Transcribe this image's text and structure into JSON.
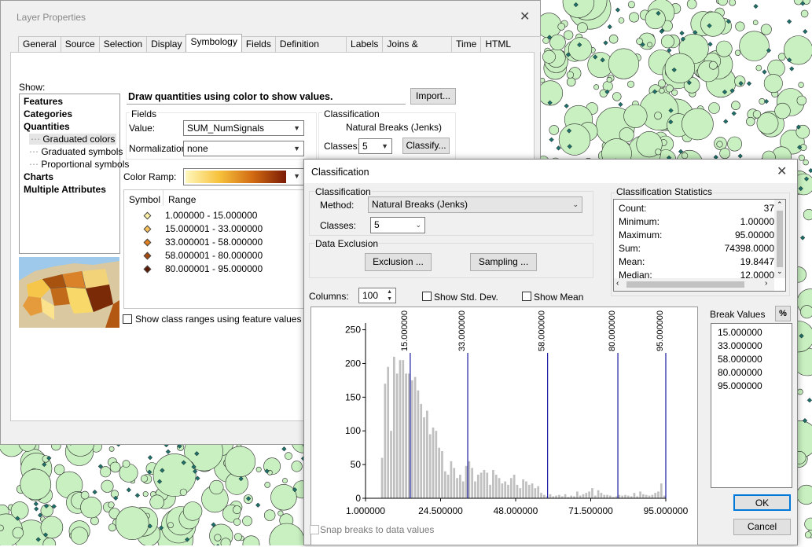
{
  "colors": {
    "map_fill": "#c8f0c0",
    "map_stroke": "#2a2a2a",
    "map_dot": "#1f6f6a",
    "ramp_start": "#fff7bc",
    "ramp_end": "#7a1a05",
    "break_line": "#1a1aa0",
    "bar": "#c0c0c0"
  },
  "layer_props": {
    "title": "Layer Properties",
    "tabs": [
      "General",
      "Source",
      "Selection",
      "Display",
      "Symbology",
      "Fields",
      "Definition Query",
      "Labels",
      "Joins & Relates",
      "Time",
      "HTML Popup"
    ],
    "active_tab": "Symbology",
    "show_label": "Show:",
    "tree": [
      {
        "label": "Features",
        "level": 0
      },
      {
        "label": "Categories",
        "level": 0
      },
      {
        "label": "Quantities",
        "level": 0
      },
      {
        "label": "Graduated colors",
        "level": 1,
        "selected": true
      },
      {
        "label": "Graduated symbols",
        "level": 1
      },
      {
        "label": "Proportional symbols",
        "level": 1
      },
      {
        "label": "Charts",
        "level": 0
      },
      {
        "label": "Multiple Attributes",
        "level": 0
      }
    ],
    "heading": "Draw quantities using color to show values.",
    "import_label": "Import...",
    "fields_group": "Fields",
    "value_label": "Value:",
    "value": "SUM_NumSignals",
    "normalization_label": "Normalization:",
    "normalization": "none",
    "classification_group": "Classification",
    "classification_method": "Natural Breaks (Jenks)",
    "classes_label": "Classes:",
    "classes": "5",
    "classify_label": "Classify...",
    "color_ramp_label": "Color Ramp:",
    "symbol_header": "Symbol",
    "range_header": "Range",
    "ranges": [
      {
        "range": "1.000000 - 15.000000",
        "color": "#fff2a8"
      },
      {
        "range": "15.000001 - 33.000000",
        "color": "#f9c25a"
      },
      {
        "range": "33.000001 - 58.000000",
        "color": "#e07f1d"
      },
      {
        "range": "58.000001 - 80.000000",
        "color": "#a84a0d"
      },
      {
        "range": "80.000001 - 95.000000",
        "color": "#5e1b04"
      }
    ],
    "show_class_ranges": "Show class ranges using feature values"
  },
  "classification": {
    "title": "Classification",
    "group_label": "Classification",
    "method_label": "Method:",
    "method": "Natural Breaks (Jenks)",
    "classes_label": "Classes:",
    "classes": "5",
    "data_exclusion_label": "Data Exclusion",
    "exclusion_btn": "Exclusion ...",
    "sampling_btn": "Sampling ...",
    "stats_label": "Classification Statistics",
    "stats": [
      {
        "name": "Count:",
        "value": "37"
      },
      {
        "name": "Minimum:",
        "value": "1.00000"
      },
      {
        "name": "Maximum:",
        "value": "95.00000"
      },
      {
        "name": "Sum:",
        "value": "74398.0000"
      },
      {
        "name": "Mean:",
        "value": "19.8447"
      },
      {
        "name": "Median:",
        "value": "12.0000"
      }
    ],
    "columns_label": "Columns:",
    "columns": "100",
    "show_std_dev": "Show Std. Dev.",
    "show_mean": "Show Mean",
    "break_values_label": "Break Values",
    "percent_btn": "%",
    "break_values": [
      "15.000000",
      "33.000000",
      "58.000000",
      "80.000000",
      "95.000000"
    ],
    "ok_label": "OK",
    "cancel_label": "Cancel",
    "snap_label": "Snap breaks to data values"
  },
  "chart_data": {
    "type": "bar",
    "xlim": [
      1,
      95
    ],
    "ylim": [
      0,
      260
    ],
    "x_ticks": [
      "1.000000",
      "24.500000",
      "48.000000",
      "71.500000",
      "95.000000"
    ],
    "y_ticks": [
      "0",
      "50",
      "100",
      "150",
      "200",
      "250"
    ],
    "break_labels": [
      "15.000000",
      "33.000000",
      "58.000000",
      "80.000000",
      "95.000000"
    ],
    "breaks": [
      15,
      33,
      58,
      80,
      95
    ],
    "values": [
      0,
      0,
      0,
      0,
      0,
      60,
      170,
      195,
      100,
      210,
      185,
      205,
      205,
      185,
      185,
      175,
      180,
      160,
      140,
      120,
      130,
      95,
      105,
      100,
      75,
      70,
      40,
      35,
      55,
      45,
      30,
      35,
      25,
      48,
      55,
      45,
      25,
      35,
      38,
      42,
      38,
      20,
      42,
      35,
      30,
      22,
      25,
      20,
      30,
      35,
      20,
      15,
      28,
      25,
      20,
      22,
      15,
      18,
      8,
      5,
      3,
      6,
      3,
      4,
      5,
      3,
      6,
      2,
      4,
      3,
      10,
      4,
      6,
      8,
      10,
      15,
      4,
      12,
      8,
      5,
      5,
      4,
      2,
      3,
      5,
      4,
      5,
      4,
      3,
      8,
      3,
      10,
      6,
      5,
      4,
      5,
      8,
      10,
      22,
      4
    ]
  }
}
